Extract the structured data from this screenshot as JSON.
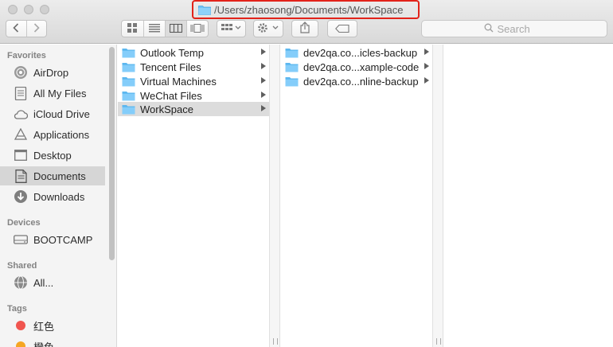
{
  "window": {
    "path_title": "/Users/zhaosong/Documents/WorkSpace"
  },
  "toolbar": {
    "back_icon": "chevron-left-icon",
    "forward_icon": "chevron-right-icon",
    "view_modes": [
      "icon-view",
      "list-view",
      "column-view",
      "cover-flow-view"
    ],
    "active_view": "column-view",
    "search_placeholder": "Search"
  },
  "sidebar": {
    "sections": {
      "favorites": "Favorites",
      "devices": "Devices",
      "shared": "Shared",
      "tags": "Tags"
    },
    "favorites": [
      {
        "label": "AirDrop",
        "icon": "airdrop-icon"
      },
      {
        "label": "All My Files",
        "icon": "all-files-icon"
      },
      {
        "label": "iCloud Drive",
        "icon": "cloud-icon"
      },
      {
        "label": "Applications",
        "icon": "applications-icon"
      },
      {
        "label": "Desktop",
        "icon": "desktop-icon"
      },
      {
        "label": "Documents",
        "icon": "documents-icon",
        "selected": true
      },
      {
        "label": "Downloads",
        "icon": "download-icon"
      }
    ],
    "devices": [
      {
        "label": "BOOTCAMP",
        "icon": "disk-icon"
      }
    ],
    "shared": [
      {
        "label": "All...",
        "icon": "network-icon"
      }
    ],
    "tags": [
      {
        "label": "红色",
        "color": "#f0554f"
      },
      {
        "label": "橙色",
        "color": "#f5a623"
      }
    ]
  },
  "columns": {
    "col1": [
      {
        "name": "Outlook Temp"
      },
      {
        "name": "Tencent Files"
      },
      {
        "name": "Virtual Machines"
      },
      {
        "name": "WeChat Files"
      },
      {
        "name": "WorkSpace",
        "selected": true
      }
    ],
    "col2": [
      {
        "name": "dev2qa.co...icles-backup"
      },
      {
        "name": "dev2qa.co...xample-code"
      },
      {
        "name": "dev2qa.co...nline-backup"
      }
    ]
  },
  "colors": {
    "highlight_border": "#e2231a",
    "folder": "#6fc3f7",
    "selection": "#dcdcdc"
  }
}
